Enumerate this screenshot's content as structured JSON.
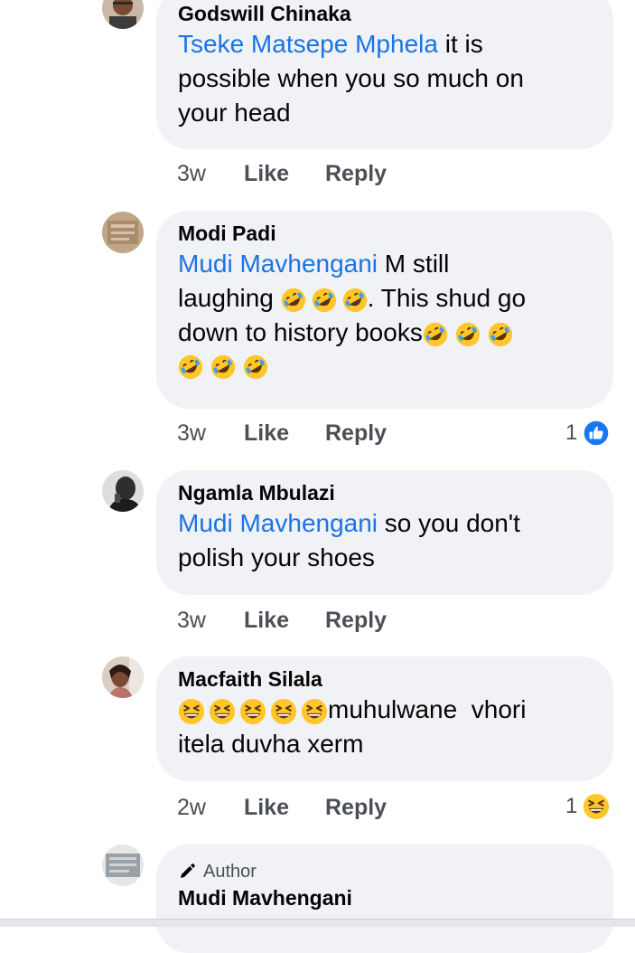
{
  "comments": [
    {
      "name": "Godswill Chinaka",
      "mention": "Tseke Matsepe Mphela",
      "text_line1_rest": " it is",
      "text_line2": "possible when you so much on",
      "text_line3": "your head",
      "time": "3w",
      "like": "Like",
      "reply": "Reply"
    },
    {
      "name": "Modi Padi",
      "mention": "Mudi Mavhengani",
      "text_line1_rest": " M still",
      "text_line2_pre": "laughing ",
      "text_line2_post": ". This shud go",
      "text_line3": "down to history books",
      "time": "3w",
      "like": "Like",
      "reply": "Reply",
      "reaction_count": "1",
      "reaction_type": "like-icon"
    },
    {
      "name": "Ngamla Mbulazi",
      "mention": "Mudi Mavhengani",
      "text_line1_rest": " so you don't",
      "text_line2": "polish your shoes",
      "time": "3w",
      "like": "Like",
      "reply": "Reply"
    },
    {
      "name": "Macfaith Silala",
      "text_line1_rest": "muhulwane  vhori",
      "text_line2": "itela duvha xerm",
      "time": "2w",
      "like": "Like",
      "reply": "Reply",
      "reaction_count": "1",
      "reaction_type": "haha-icon"
    },
    {
      "author_badge": "Author",
      "name": "Mudi Mavhengani"
    }
  ],
  "colors": {
    "mention": "#1b74e4",
    "bubble": "#f0f2f5",
    "like_blue": "#1877f2",
    "emoji_yellow": "#ffcc33"
  }
}
